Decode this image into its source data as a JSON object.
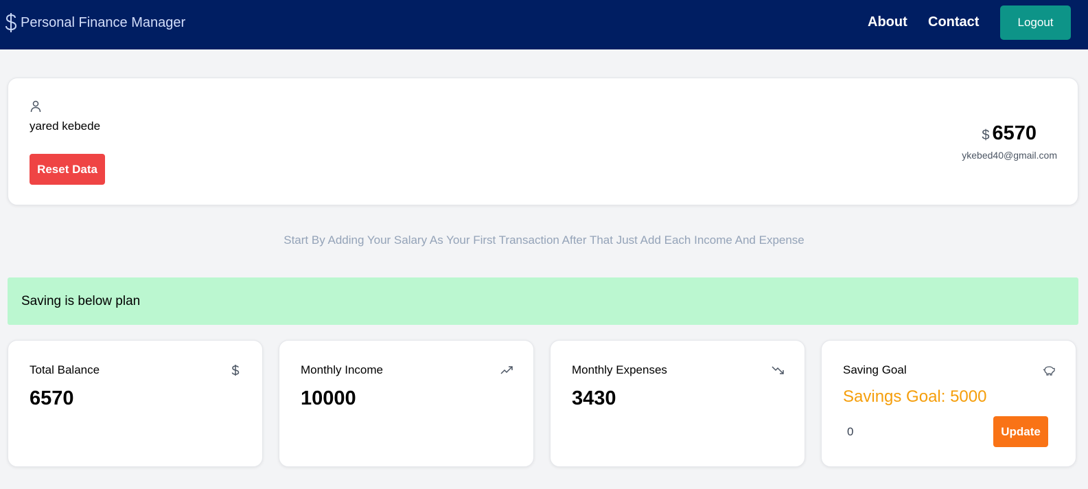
{
  "navbar": {
    "brand_icon": "dollar-icon",
    "brand": "Personal Finance Manager",
    "links": [
      {
        "label": "About"
      },
      {
        "label": "Contact"
      }
    ],
    "logout_label": "Logout",
    "background": "#001e62",
    "logout_color": "#0d9488"
  },
  "profile": {
    "icon": "user-icon",
    "name": "yared kebede",
    "reset_label": "Reset Data",
    "balance_currency": "$",
    "balance": "6570",
    "email": "ykebed40@gmail.com",
    "reset_color": "#ef4444"
  },
  "hint": "Start By Adding Your Salary As Your First Transaction After That Just Add Each Income And Expense",
  "alert": {
    "message": "Saving is below plan",
    "color": "#bbf7d0"
  },
  "stats": [
    {
      "title": "Total Balance",
      "value": "6570",
      "icon": "dollar-icon"
    },
    {
      "title": "Monthly Income",
      "value": "10000",
      "icon": "trending-up-icon"
    },
    {
      "title": "Monthly Expenses",
      "value": "3430",
      "icon": "trending-down-icon"
    }
  ],
  "saving_goal": {
    "title": "Saving Goal",
    "icon": "piggy-bank-icon",
    "goal_text": "Savings Goal: 5000",
    "input_value": "0",
    "update_label": "Update",
    "goal_color": "#f59e0b",
    "update_color": "#f97316"
  }
}
